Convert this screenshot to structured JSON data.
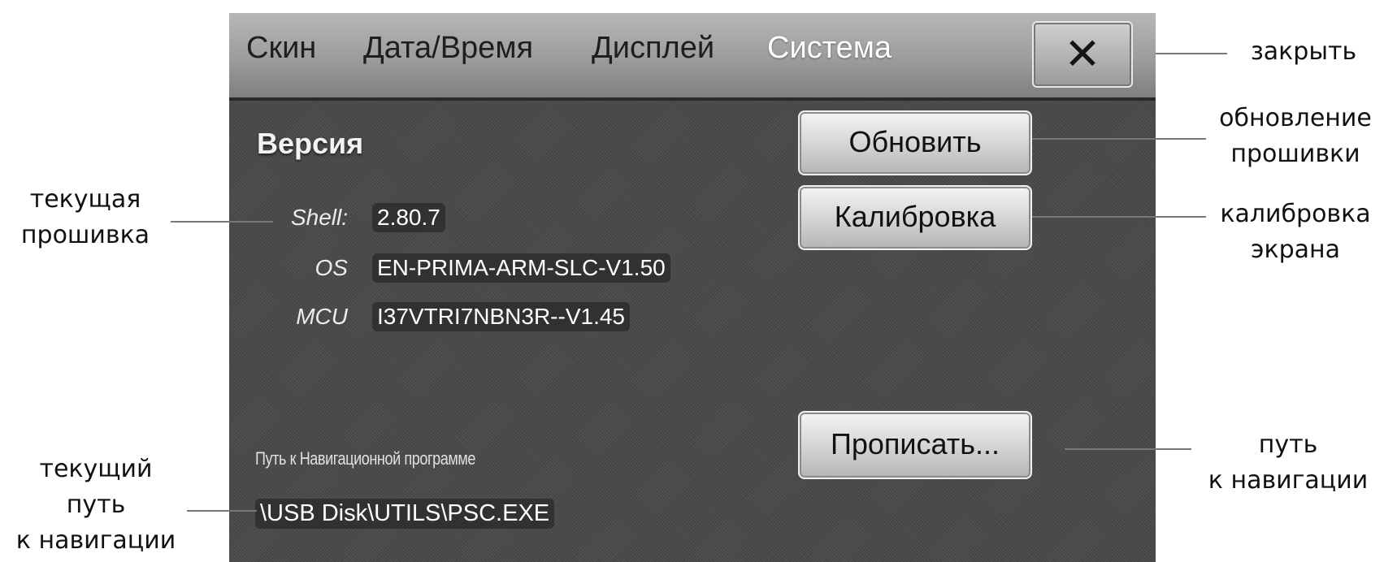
{
  "tabs": {
    "skin": "Скин",
    "datetime": "Дата/Время",
    "display": "Дисплей",
    "system": "Система"
  },
  "close_symbol": "✕",
  "version": {
    "heading": "Версия",
    "shell_label": "Shell:",
    "shell_value": "2.80.7",
    "os_label": "OS",
    "os_value": "EN-PRIMA-ARM-SLC-V1.50",
    "mcu_label": "MCU",
    "mcu_value": "I37VTRI7NBN3R--V1.45"
  },
  "buttons": {
    "update": "Обновить",
    "calibrate": "Калибровка",
    "set_path": "Прописать..."
  },
  "navigation": {
    "label": "Путь к Навигационной программе",
    "path": "\\USB Disk\\UTILS\\PSC.EXE"
  },
  "annotations": {
    "close": "закрыть",
    "firmware_update": [
      "обновление",
      "прошивки"
    ],
    "screen_calibration": [
      "калибровка",
      "экрана"
    ],
    "nav_path": [
      "путь",
      "к навигации"
    ],
    "current_firmware": [
      "текущая",
      "прошивка"
    ],
    "current_nav_path": [
      "текущий",
      "путь",
      "к навигации"
    ]
  }
}
